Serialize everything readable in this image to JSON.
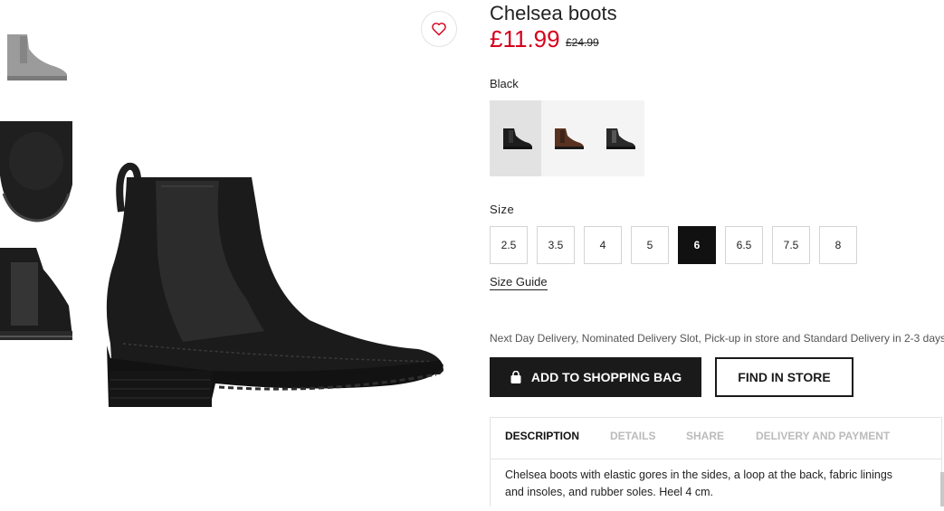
{
  "product": {
    "title": "Chelsea boots",
    "price": "£11.99",
    "old_price": "£24.99"
  },
  "colour": {
    "selected_label": "Black",
    "swatches": [
      {
        "name": "black",
        "color": "#1c1c1c",
        "selected": true
      },
      {
        "name": "brown",
        "color": "#5a3220",
        "selected": false
      },
      {
        "name": "dark-grey",
        "color": "#2a2a2a",
        "selected": false
      }
    ]
  },
  "size": {
    "label": "Size",
    "options": [
      "2.5",
      "3.5",
      "4",
      "5",
      "6",
      "6.5",
      "7.5",
      "8"
    ],
    "selected": "6",
    "guide_label": "Size Guide"
  },
  "delivery_text": "Next Day Delivery, Nominated Delivery Slot, Pick-up in store and Standard Delivery in 2-3 days.",
  "buttons": {
    "add_to_bag": "ADD TO SHOPPING BAG",
    "find_in_store": "FIND IN STORE"
  },
  "tabs": [
    "DESCRIPTION",
    "DETAILS",
    "SHARE",
    "DELIVERY AND PAYMENT"
  ],
  "active_tab": "DESCRIPTION",
  "description": "Chelsea boots with elastic gores in the sides, a loop at the back, fabric linings and insoles, and rubber soles. Heel 4 cm.",
  "icons": {
    "favourite": "heart-icon",
    "bag": "shopping-bag-icon"
  },
  "colors": {
    "sale_red": "#d6001c",
    "heart_red": "#d6001c",
    "dark_button": "#1a1a1a"
  }
}
